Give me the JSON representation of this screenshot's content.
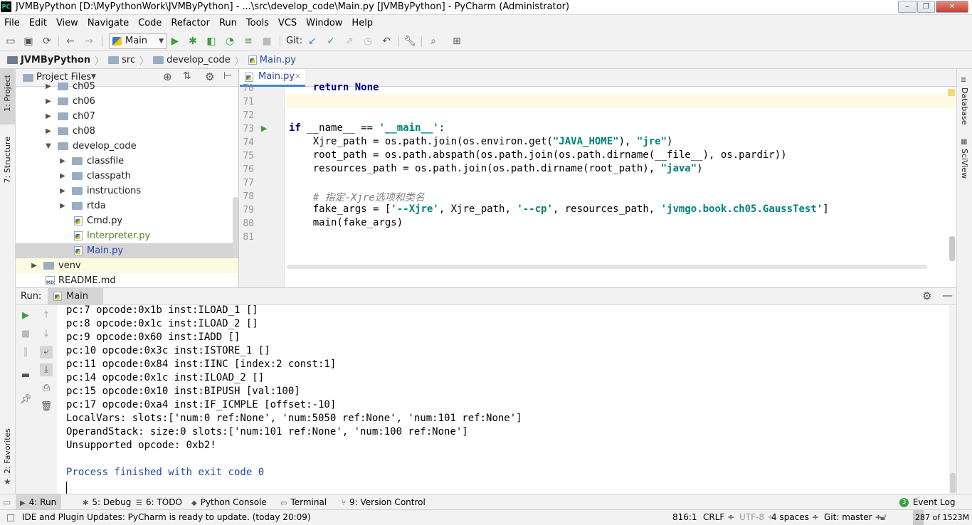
{
  "window": {
    "app_icon": "PC",
    "title": "JVMByPython [D:\\MyPythonWork\\JVMByPython] - ...\\src\\develop_code\\Main.py [JVMByPython] - PyCharm (Administrator)",
    "minimize_icon": "minimize-icon",
    "maximize_icon": "maximize-icon",
    "close_icon": "close-icon"
  },
  "menu": [
    "File",
    "Edit",
    "View",
    "Navigate",
    "Code",
    "Refactor",
    "Run",
    "Tools",
    "VCS",
    "Window",
    "Help"
  ],
  "toolbar": {
    "run_config": "Main",
    "git_label": "Git:"
  },
  "breadcrumb": [
    "JVMByPython",
    "src",
    "develop_code",
    "Main.py"
  ],
  "left_strip": {
    "project": "1: Project",
    "structure": "7: Structure",
    "favorites": "2: Favorites"
  },
  "right_strip": {
    "database": "Database",
    "sciview": "SciView"
  },
  "project_panel": {
    "title": "Project Files",
    "tree": [
      {
        "label": "ch05",
        "type": "folder",
        "depth": 1,
        "expanded": false
      },
      {
        "label": "ch06",
        "type": "folder",
        "depth": 1,
        "expanded": false
      },
      {
        "label": "ch07",
        "type": "folder",
        "depth": 1,
        "expanded": false
      },
      {
        "label": "ch08",
        "type": "folder",
        "depth": 1,
        "expanded": false
      },
      {
        "label": "develop_code",
        "type": "folder",
        "depth": 1,
        "expanded": true
      },
      {
        "label": "classfile",
        "type": "folder",
        "depth": 2,
        "expanded": false
      },
      {
        "label": "classpath",
        "type": "folder",
        "depth": 2,
        "expanded": false
      },
      {
        "label": "instructions",
        "type": "folder",
        "depth": 2,
        "expanded": false
      },
      {
        "label": "rtda",
        "type": "folder",
        "depth": 2,
        "expanded": false
      },
      {
        "label": "Cmd.py",
        "type": "py",
        "depth": 2
      },
      {
        "label": "Interpreter.py",
        "type": "py",
        "depth": 2,
        "color": "#4e8a1e"
      },
      {
        "label": "Main.py",
        "type": "py",
        "depth": 2,
        "selected": true,
        "color": "#2447a8"
      },
      {
        "label": "venv",
        "type": "folder",
        "depth": 0,
        "expanded": false,
        "highlight": true
      },
      {
        "label": "README.md",
        "type": "md",
        "depth": 0
      }
    ]
  },
  "editor": {
    "tab_label": "Main.py",
    "lines": [
      {
        "n": "70",
        "text": "    return None"
      },
      {
        "n": "71",
        "text": ""
      },
      {
        "n": "72",
        "text": ""
      },
      {
        "n": "73",
        "text": "if __name__ == '__main__':"
      },
      {
        "n": "74",
        "text": "    Xjre_path = os.path.join(os.environ.get(\"JAVA_HOME\"), \"jre\")"
      },
      {
        "n": "75",
        "text": "    root_path = os.path.abspath(os.path.join(os.path.dirname(__file__), os.pardir))"
      },
      {
        "n": "76",
        "text": "    resources_path = os.path.join(os.path.dirname(root_path), \"java\")"
      },
      {
        "n": "77",
        "text": ""
      },
      {
        "n": "78",
        "text": "    # 指定-Xjre选项和类名"
      },
      {
        "n": "79",
        "text": "    fake_args = ['--Xjre', Xjre_path, '--cp', resources_path, 'jvmgo.book.ch05.GaussTest']"
      },
      {
        "n": "80",
        "text": "    main(fake_args)"
      },
      {
        "n": "81",
        "text": ""
      }
    ]
  },
  "run_panel": {
    "label": "Run:",
    "tab": "Main",
    "console": [
      "pc:7 opcode:0x1b inst:ILOAD_1 []",
      "pc:8 opcode:0x1c inst:ILOAD_2 []",
      "pc:9 opcode:0x60 inst:IADD []",
      "pc:10 opcode:0x3c inst:ISTORE_1 []",
      "pc:11 opcode:0x84 inst:IINC [index:2 const:1]",
      "pc:14 opcode:0x1c inst:ILOAD_2 []",
      "pc:15 opcode:0x10 inst:BIPUSH [val:100]",
      "pc:17 opcode:0xa4 inst:IF_ICMPLE [offset:-10]",
      "LocalVars: slots:['num:0 ref:None', 'num:5050 ref:None', 'num:101 ref:None']",
      "OperandStack: size:0 slots:['num:101 ref:None', 'num:100 ref:None']",
      "Unsupported opcode: 0xb2!",
      "",
      "Process finished with exit code 0"
    ]
  },
  "bottom_tabs": [
    {
      "label": "4: Run",
      "icon": "run-icon",
      "active": true
    },
    {
      "label": "5: Debug",
      "icon": "bug-icon"
    },
    {
      "label": "6: TODO",
      "icon": "todo-icon"
    },
    {
      "label": "Python Console",
      "icon": "python-icon"
    },
    {
      "label": "Terminal",
      "icon": "terminal-icon"
    },
    {
      "label": "9: Version Control",
      "icon": "vcs-icon"
    }
  ],
  "event_log": {
    "count": "3",
    "label": "Event Log"
  },
  "status": {
    "message": "IDE and Plugin Updates: PyCharm is ready to update. (today 20:09)",
    "position": "816:1",
    "line_sep": "CRLF ÷",
    "encoding": "UTF-8 ÷",
    "indent": "4 spaces ÷",
    "git": "Git: master ÷",
    "memory": "287 of 1523M"
  },
  "colors": {
    "accent": "#4083c9",
    "selection": "#d5d5d5",
    "run_green": "#3d9f3d",
    "keyword": "#000080",
    "string": "#008080"
  }
}
